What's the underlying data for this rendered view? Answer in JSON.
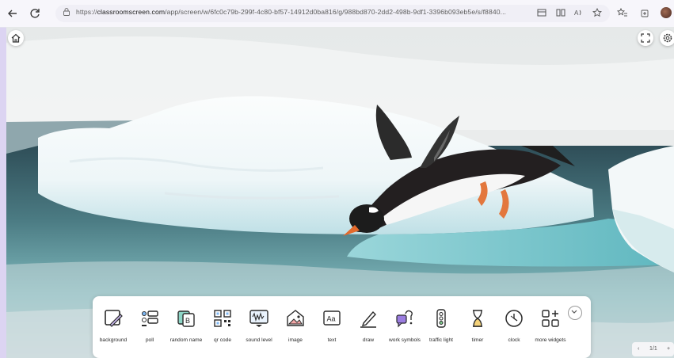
{
  "browser": {
    "url_prefix": "https://",
    "url_host": "classroomscreen.com",
    "url_path": "/app/screen/w/6fc0c79b-299f-4c80-bf57-14912d0ba816/g/988bd870-2dd2-498b-9df1-3396b093eb5e/s/f8840...",
    "icons": [
      "back-icon",
      "refresh-icon",
      "lock-icon",
      "tab-icon",
      "reading-view-icon",
      "read-aloud-icon",
      "favorite-icon",
      "favorites-icon",
      "collections-icon",
      "profile-avatar"
    ]
  },
  "stage": {
    "background_image": "penguin diving from iceberg",
    "colors": {
      "sky": "#ebeeee",
      "ice": "#f7fbfd",
      "water_light": "#7ec7c9",
      "water_dark": "#3c6470"
    }
  },
  "toolbar": {
    "tools": [
      {
        "id": "background",
        "label": "background",
        "icon": "background-icon"
      },
      {
        "id": "poll",
        "label": "poll",
        "icon": "poll-icon"
      },
      {
        "id": "random-name",
        "label": "random name",
        "icon": "random-name-icon"
      },
      {
        "id": "qr-code",
        "label": "qr code",
        "icon": "qr-code-icon"
      },
      {
        "id": "sound-level",
        "label": "sound level",
        "icon": "sound-level-icon"
      },
      {
        "id": "image",
        "label": "image",
        "icon": "image-icon"
      },
      {
        "id": "text",
        "label": "text",
        "icon": "text-icon"
      },
      {
        "id": "draw",
        "label": "draw",
        "icon": "draw-icon"
      },
      {
        "id": "work-symbols",
        "label": "work symbols",
        "icon": "work-symbols-icon"
      },
      {
        "id": "traffic-light",
        "label": "traffic light",
        "icon": "traffic-light-icon"
      },
      {
        "id": "timer",
        "label": "timer",
        "icon": "timer-icon"
      },
      {
        "id": "clock",
        "label": "clock",
        "icon": "clock-icon"
      },
      {
        "id": "more-widgets",
        "label": "more widgets",
        "icon": "more-widgets-icon"
      }
    ],
    "accent_color": "#2a2a2a"
  },
  "pager": {
    "prev": "‹",
    "page": "1/1",
    "add": "+"
  }
}
